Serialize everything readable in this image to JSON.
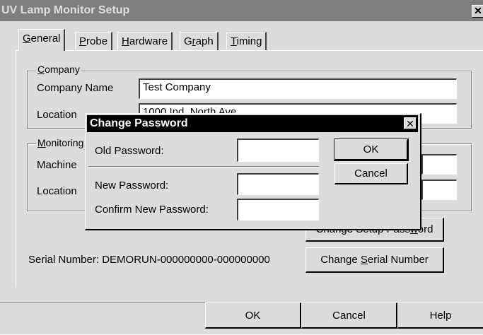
{
  "window": {
    "title": "UV Lamp Monitor Setup",
    "close": "✕"
  },
  "tabs": [
    {
      "pre": "",
      "u": "G",
      "post": "eneral"
    },
    {
      "pre": "",
      "u": "P",
      "post": "robe"
    },
    {
      "pre": "",
      "u": "H",
      "post": "ardware"
    },
    {
      "pre": "G",
      "u": "r",
      "post": "aph"
    },
    {
      "pre": "",
      "u": "T",
      "post": "iming"
    }
  ],
  "company": {
    "group_u": "C",
    "group_rest": "ompany",
    "name_label": "Company Name",
    "name_value": "Test Company",
    "location_label": "Location",
    "location_value": "1000 Ind. North Ave"
  },
  "monitoring": {
    "group_u": "M",
    "group_rest": "onitoring",
    "machine_label": "Machine",
    "location_label": "Location"
  },
  "serial": {
    "text": "Serial Number: DEMORUN-000000000-000000000"
  },
  "buttons": {
    "change_setup_pre": "Change Setup Pass",
    "change_setup_u": "w",
    "change_setup_post": "ord",
    "change_serial_pre": "Change ",
    "change_serial_u": "S",
    "change_serial_post": "erial Number",
    "ok": "OK",
    "cancel": "Cancel",
    "help": "Help"
  },
  "dialog": {
    "title": "Change Password",
    "close": "✕",
    "old_label": "Old Password:",
    "new_label": "New Password:",
    "confirm_label": "Confirm New Password:",
    "ok": "OK",
    "cancel": "Cancel"
  }
}
